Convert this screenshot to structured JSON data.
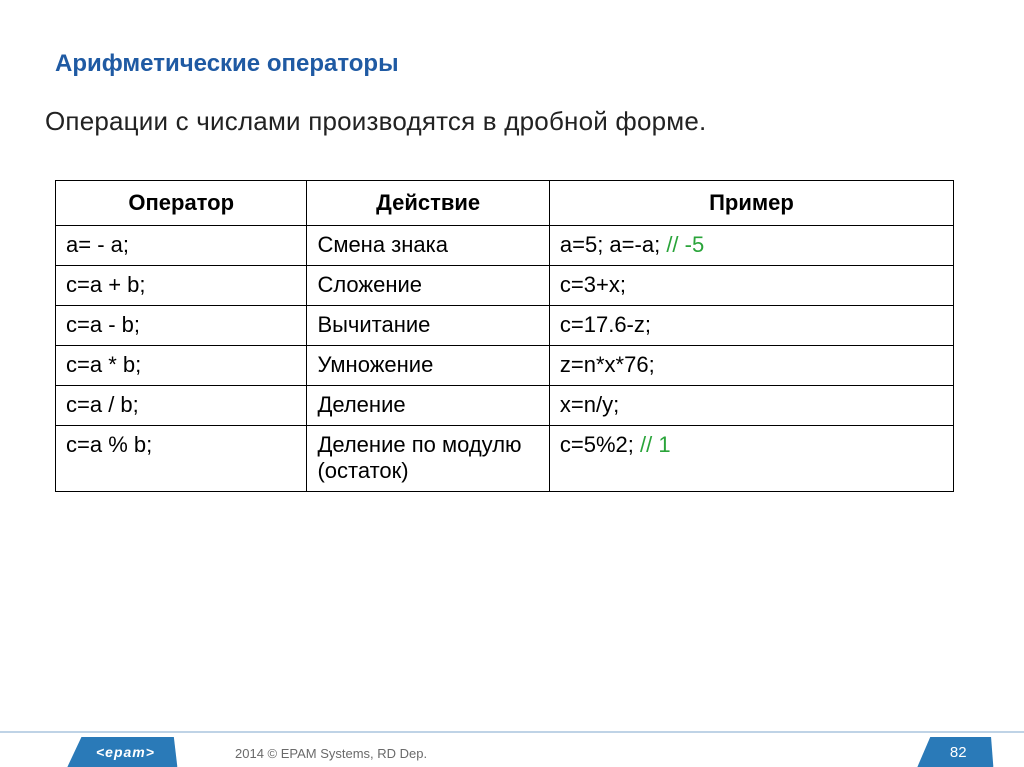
{
  "title": "Арифметические операторы",
  "subtitle": "Операции с числами производятся в дробной форме.",
  "headers": {
    "c1": "Оператор",
    "c2": "Действие",
    "c3": "Пример"
  },
  "rows": [
    {
      "op": "a= - a;",
      "act": "Смена знака",
      "ex": "a=5; a=-a; ",
      "comment": "// -5"
    },
    {
      "op": "c=a + b;",
      "act": "Сложение",
      "ex": "c=3+x;",
      "comment": ""
    },
    {
      "op": "c=a - b;",
      "act": "Вычитание",
      "ex": "c=17.6-z;",
      "comment": ""
    },
    {
      "op": "c=a * b;",
      "act": "Умножение",
      "ex": "z=n*x*76;",
      "comment": ""
    },
    {
      "op": "c=a / b;",
      "act": "Деление",
      "ex": "x=n/y;",
      "comment": ""
    },
    {
      "op": "c=a % b;",
      "act": "Деление по модулю (остаток)",
      "ex": "c=5%2; ",
      "comment": "// 1"
    }
  ],
  "footer": {
    "logo": "<epam>",
    "copyright": "2014 © EPAM Systems, RD Dep.",
    "page": "82"
  }
}
